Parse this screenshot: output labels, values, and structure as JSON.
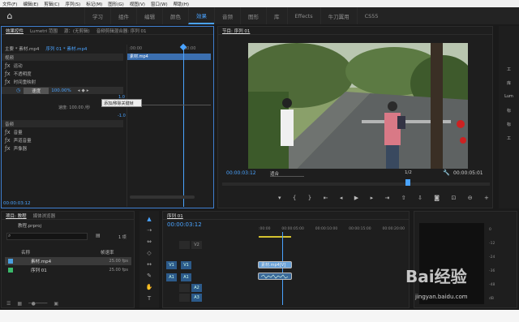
{
  "menu": [
    "文件(F)",
    "编辑(E)",
    "剪辑(C)",
    "序列(S)",
    "标记(M)",
    "图形(G)",
    "视图(V)",
    "窗口(W)",
    "帮助(H)"
  ],
  "workspaces": [
    "学习",
    "组件",
    "编辑",
    "颜色",
    "效果",
    "音频",
    "图形",
    "库",
    "Effects",
    "牛刀翼用",
    "CS55"
  ],
  "active_workspace": "效果",
  "effect_controls": {
    "tabs": [
      "效果控件",
      "Lumetri 范围",
      "源：(无剪辑)",
      "音频剪辑混合器: 序列 01"
    ],
    "header_left": "主要 * 素材.mp4",
    "header_right": "序列 01 * 素材.mp4",
    "timecodes": [
      ":00:00",
      "00:00"
    ],
    "clip_label": "素材.mp4",
    "section_video": "视频",
    "motion": "运动",
    "opacity": "不透明度",
    "time_remap": "时间重映射",
    "speed": "速度",
    "speed_value": "100.00%",
    "velocity": "速度: 100.00 /秒",
    "tooltip": "添加/移除关键帧",
    "y_values": [
      "1.0",
      "-1.0"
    ],
    "section_audio": "音频",
    "volume": "音量",
    "channel_volume": "声道音量",
    "panner": "声像器",
    "bottom_timecode": "00:00:03:12"
  },
  "program": {
    "tab": "节目: 序列 01",
    "current_time": "00:00:03:12",
    "fit": "适合",
    "quality": "1/2",
    "duration": "00:00:05:01"
  },
  "project": {
    "tabs": [
      "项目: 教程",
      "媒体浏览器"
    ],
    "file": "教程.prproj",
    "search_placeholder": "",
    "count": "1 项",
    "col_name": "名称",
    "col_fps": "帧速率",
    "items": [
      {
        "name": "素材.mp4",
        "fps": "25.00 fps",
        "color": "#4a9fe0"
      },
      {
        "name": "序列 01",
        "fps": "25.00 fps",
        "color": "#3ab86a"
      }
    ]
  },
  "timeline": {
    "tab": "序列 01",
    "timecode": "00:00:03:12",
    "ruler": [
      ":00:00",
      "00:00:05:00",
      "00:00:10:00",
      "00:00:15:00",
      "00:00:20:00"
    ],
    "tracks": [
      {
        "label": "V2",
        "on": false
      },
      {
        "label": "V1",
        "on": true
      },
      {
        "label": "A1",
        "on": true
      },
      {
        "label": "A2",
        "on": false
      },
      {
        "label": "A3",
        "on": false
      }
    ],
    "video_clip": "素材.mp4[V]",
    "meter_db": [
      "0",
      "-12",
      "-24",
      "-36",
      "-48",
      "dB"
    ]
  },
  "right_tools": [
    "工",
    "库",
    "Lum",
    "标",
    "标",
    "工"
  ],
  "watermark": "Bai经验",
  "watermark_url": "jingyan.baidu.com"
}
